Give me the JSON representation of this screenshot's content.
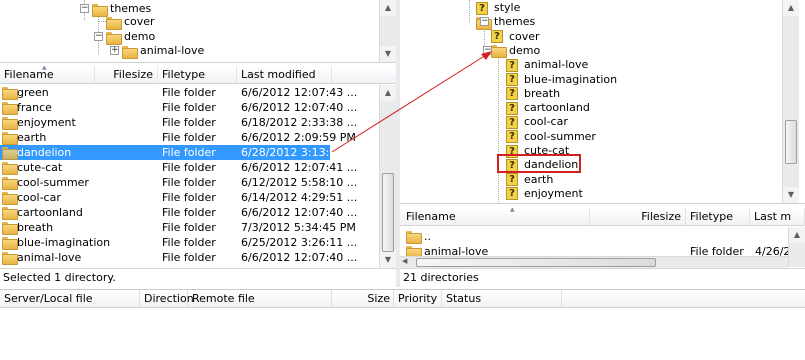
{
  "left_tree": {
    "items": [
      {
        "label": "themes",
        "icon": "folder-icon"
      },
      {
        "label": "cover",
        "icon": "folder-icon"
      },
      {
        "label": "demo",
        "icon": "folder-icon"
      },
      {
        "label": "animal-love",
        "icon": "folder-icon"
      }
    ]
  },
  "left_list": {
    "columns": [
      "Filename",
      "Filesize",
      "Filetype",
      "Last modified"
    ],
    "rows": [
      {
        "name": "green",
        "type": "File folder",
        "modified": "6/6/2012 12:07:43 ..."
      },
      {
        "name": "france",
        "type": "File folder",
        "modified": "6/6/2012 12:07:40 ..."
      },
      {
        "name": "enjoyment",
        "type": "File folder",
        "modified": "6/18/2012 2:33:38 ..."
      },
      {
        "name": "earth",
        "type": "File folder",
        "modified": "6/6/2012 2:09:59 PM"
      },
      {
        "name": "dandelion",
        "type": "File folder",
        "modified": "6/28/2012 3:13:05 ...",
        "selected": true
      },
      {
        "name": "cute-cat",
        "type": "File folder",
        "modified": "6/6/2012 12:07:41 ..."
      },
      {
        "name": "cool-summer",
        "type": "File folder",
        "modified": "6/12/2012 5:58:10 ..."
      },
      {
        "name": "cool-car",
        "type": "File folder",
        "modified": "6/14/2012 4:29:51 ..."
      },
      {
        "name": "cartoonland",
        "type": "File folder",
        "modified": "6/6/2012 12:07:40 ..."
      },
      {
        "name": "breath",
        "type": "File folder",
        "modified": "7/3/2012 5:34:45 PM"
      },
      {
        "name": "blue-imagination",
        "type": "File folder",
        "modified": "6/25/2012 3:26:11 ..."
      },
      {
        "name": "animal-love",
        "type": "File folder",
        "modified": "6/6/2012 12:07:40 ..."
      }
    ],
    "status": "Selected 1 directory."
  },
  "right_tree": {
    "items": [
      {
        "label": "style",
        "icon": "unknown-folder-icon"
      },
      {
        "label": "themes",
        "icon": "folder-icon"
      },
      {
        "label": "cover",
        "icon": "unknown-folder-icon"
      },
      {
        "label": "demo",
        "icon": "folder-icon"
      },
      {
        "label": "animal-love",
        "icon": "unknown-folder-icon"
      },
      {
        "label": "blue-imagination",
        "icon": "unknown-folder-icon"
      },
      {
        "label": "breath",
        "icon": "unknown-folder-icon"
      },
      {
        "label": "cartoonland",
        "icon": "unknown-folder-icon"
      },
      {
        "label": "cool-car",
        "icon": "unknown-folder-icon"
      },
      {
        "label": "cool-summer",
        "icon": "unknown-folder-icon"
      },
      {
        "label": "cute-cat",
        "icon": "unknown-folder-icon"
      },
      {
        "label": "dandelion",
        "icon": "unknown-folder-icon",
        "highlighted": true
      },
      {
        "label": "earth",
        "icon": "unknown-folder-icon"
      },
      {
        "label": "enjoyment",
        "icon": "unknown-folder-icon"
      }
    ]
  },
  "right_list": {
    "columns": [
      "Filename",
      "Filesize",
      "Filetype",
      "Last m"
    ],
    "rows": [
      {
        "name": "..",
        "type": "",
        "modified": ""
      },
      {
        "name": "animal-love",
        "type": "File folder",
        "modified": "4/26/2"
      }
    ],
    "status": "21 directories"
  },
  "queue": {
    "columns": [
      "Server/Local file",
      "Direction",
      "Remote file",
      "Size",
      "Priority",
      "Status"
    ]
  },
  "colors": {
    "selection": "#3399ff",
    "annotation": "#d21f1f"
  }
}
